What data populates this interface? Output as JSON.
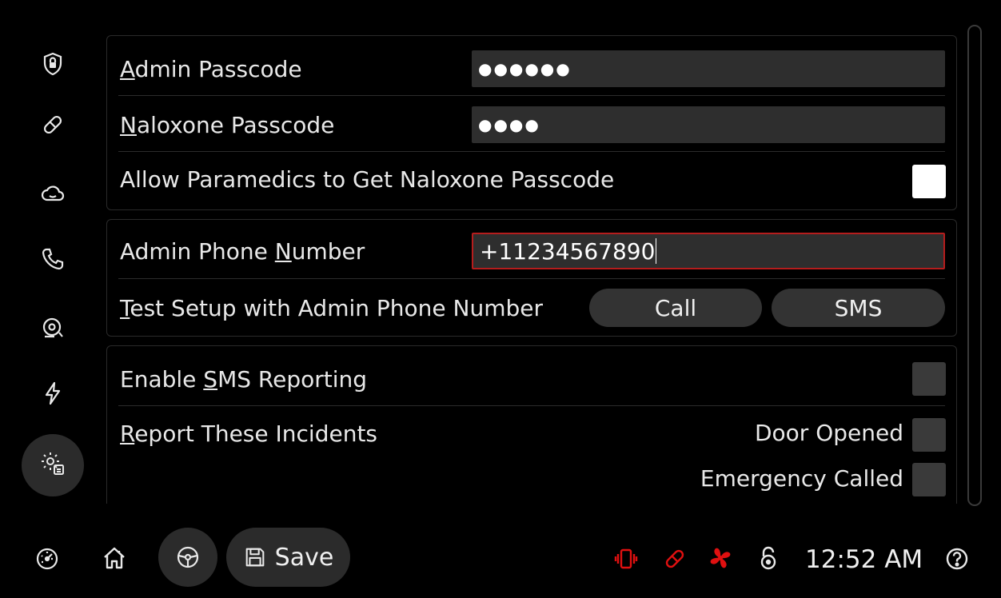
{
  "passcodes": {
    "admin_label_first": "A",
    "admin_label_rest": "dmin Passcode",
    "admin_value": "●●●●●●",
    "naloxone_label_first": "N",
    "naloxone_label_rest": "aloxone Passcode",
    "naloxone_value": "●●●●",
    "allow_paramedics_label": "Allow Paramedics to Get Naloxone Passcode",
    "allow_paramedics_checked": true
  },
  "phone": {
    "label_before": "Admin Phone ",
    "label_underlined": "N",
    "label_after": "umber",
    "value": "+11234567890",
    "test_label_first": "T",
    "test_label_rest": "est Setup with Admin Phone Number",
    "call_label": "Call",
    "sms_label": "SMS"
  },
  "reporting": {
    "enable_label_before": "Enable ",
    "enable_label_underlined": "S",
    "enable_label_after": "MS Reporting",
    "enable_checked": false,
    "report_label_first": "R",
    "report_label_rest": "eport These Incidents",
    "incidents": [
      {
        "label": "Door Opened",
        "checked": false
      },
      {
        "label": "Emergency Called",
        "checked": false
      }
    ]
  },
  "sidebar": {
    "items": [
      {
        "icon": "shield-lock-icon"
      },
      {
        "icon": "pill-icon"
      },
      {
        "icon": "cloud-icon"
      },
      {
        "icon": "phone-icon"
      },
      {
        "icon": "alarm-bell-icon"
      },
      {
        "icon": "lightning-icon"
      },
      {
        "icon": "settings-gear-icon",
        "active": true
      }
    ]
  },
  "bottom_bar": {
    "save_label": "Save",
    "time": "12:52 AM",
    "status_icons": [
      "vibration-alert-icon",
      "pill-alert-icon",
      "fan-alert-icon",
      "unlock-icon"
    ]
  },
  "colors": {
    "alert_red": "#e01010",
    "focus_red": "#b51d1d",
    "panel_border": "#2a2a2a",
    "field_bg": "#2e2e2e",
    "button_bg": "#333333"
  }
}
